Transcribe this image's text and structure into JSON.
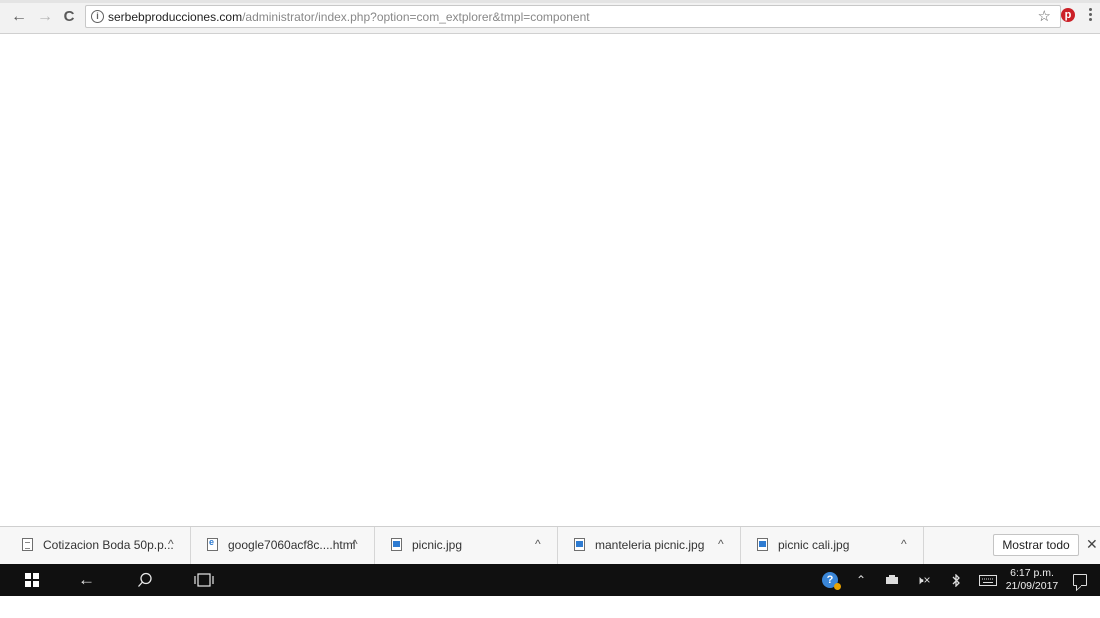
{
  "browser": {
    "url_host": "serbebproducciones.com",
    "url_path": "/administrator/index.php?option=com_extplorer&tmpl=component",
    "icons": [
      "back-arrow-icon",
      "forward-arrow-icon",
      "reload-icon",
      "info-icon",
      "star-icon",
      "pinterest-icon",
      "more-menu-icon"
    ]
  },
  "downloads": {
    "items": [
      {
        "name": "Cotizacion Boda 50p.p...",
        "icon": "document-file-icon"
      },
      {
        "name": "google7060acf8c....html",
        "icon": "html-file-icon"
      },
      {
        "name": "picnic.jpg",
        "icon": "image-file-icon"
      },
      {
        "name": "manteleria picnic.jpg",
        "icon": "image-file-icon"
      },
      {
        "name": "picnic cali.jpg",
        "icon": "image-file-icon"
      }
    ],
    "show_all_label": "Mostrar todo",
    "close_glyph": "✕",
    "caret_glyph": "^"
  },
  "taskbar": {
    "clock_time": "6:17 p.m.",
    "clock_date": "21/09/2017",
    "accent": "#101010"
  }
}
